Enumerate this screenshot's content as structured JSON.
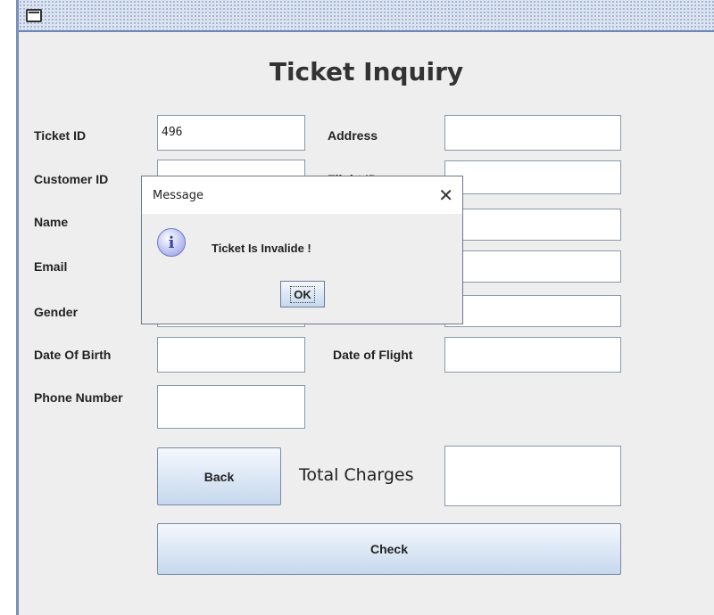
{
  "window": {
    "title": ""
  },
  "form": {
    "heading": "Ticket Inquiry",
    "labels": {
      "ticket_id": "Ticket ID",
      "customer_id": "Customer ID",
      "name": "Name",
      "email": "Email",
      "gender": "Gender",
      "date_of_birth": "Date Of Birth",
      "phone_number": "Phone Number",
      "address": "Address",
      "flight_id": "Flight ID",
      "date_of_flight": "Date of Flight",
      "total_charges": "Total Charges"
    },
    "values": {
      "ticket_id": "496",
      "customer_id": "",
      "name": "",
      "email": "",
      "gender": "",
      "date_of_birth": "",
      "phone_number": "",
      "address": "",
      "flight_id": "",
      "field_r3": "",
      "field_r4": "",
      "field_r5": "",
      "date_of_flight": "",
      "total_charges": ""
    },
    "buttons": {
      "back": "Back",
      "check": "Check"
    }
  },
  "dialog": {
    "title": "Message",
    "close_glyph": "✕",
    "icon": "info-icon",
    "icon_glyph": "i",
    "message": "Ticket Is Invalide !",
    "ok_label": "OK"
  }
}
